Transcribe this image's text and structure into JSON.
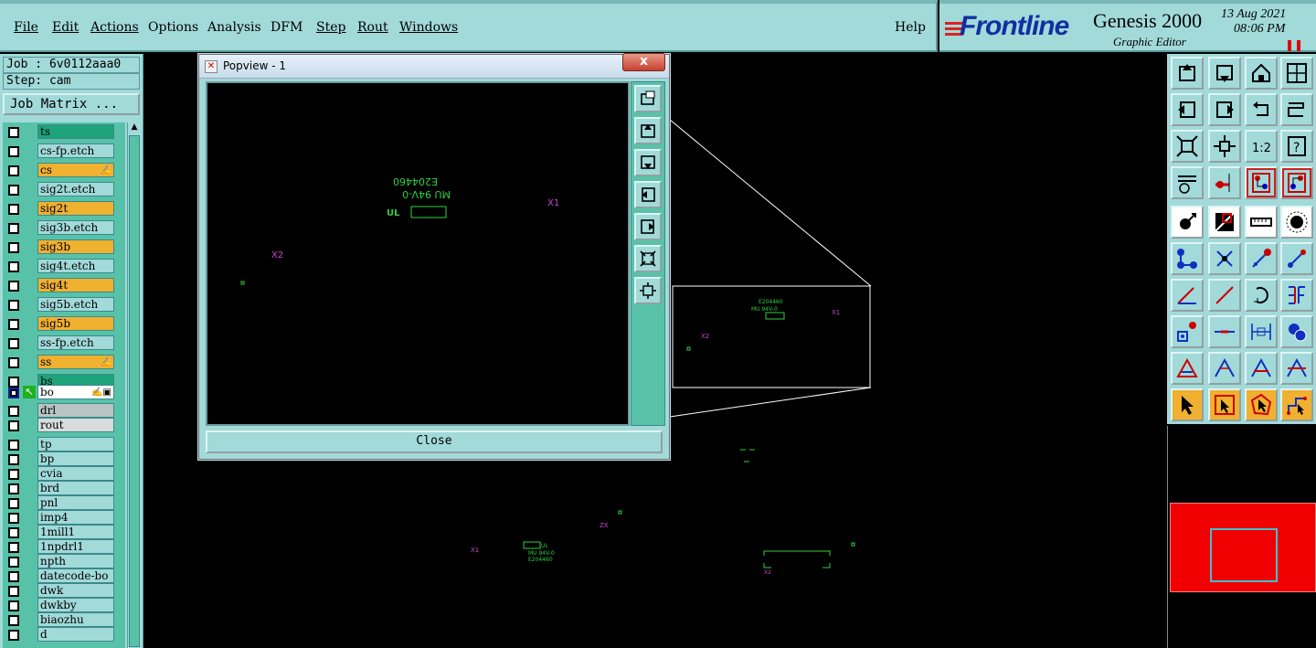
{
  "menubar": {
    "items": [
      {
        "label": "File"
      },
      {
        "label": "Edit"
      },
      {
        "label": "Actions"
      },
      {
        "label": "Options"
      },
      {
        "label": "Analysis"
      },
      {
        "label": "DFM"
      },
      {
        "label": "Step"
      },
      {
        "label": "Rout"
      },
      {
        "label": "Windows"
      }
    ],
    "help": "Help"
  },
  "logo": {
    "brand": "Frontline",
    "product": "Genesis 2000",
    "subtitle": "Graphic Editor",
    "date": "13 Aug 2021",
    "time": "08:06 PM",
    "pause_icon": "pause-icon",
    "brand_color": "#1030a0",
    "accent_color": "#e02020"
  },
  "job": {
    "job_line": "Job : 6v0112aaa0",
    "step_line": "Step: cam",
    "matrix_button": "Job Matrix ..."
  },
  "layers": [
    {
      "name": "ts",
      "color": "#1fa37a",
      "mark": ""
    },
    {
      "name": "cs-fp.etch",
      "color": "#a2d9d9",
      "mark": ""
    },
    {
      "name": "cs",
      "color": "#f0b030",
      "mark": "✍"
    },
    {
      "name": "sig2t.etch",
      "color": "#a2d9d9",
      "mark": ""
    },
    {
      "name": "sig2t",
      "color": "#f0b030",
      "mark": ""
    },
    {
      "name": "sig3b.etch",
      "color": "#a2d9d9",
      "mark": ""
    },
    {
      "name": "sig3b",
      "color": "#f0b030",
      "mark": ""
    },
    {
      "name": "sig4t.etch",
      "color": "#a2d9d9",
      "mark": ""
    },
    {
      "name": "sig4t",
      "color": "#f0b030",
      "mark": ""
    },
    {
      "name": "sig5b.etch",
      "color": "#a2d9d9",
      "mark": ""
    },
    {
      "name": "sig5b",
      "color": "#f0b030",
      "mark": ""
    },
    {
      "name": "ss-fp.etch",
      "color": "#a2d9d9",
      "mark": ""
    },
    {
      "name": "ss",
      "color": "#f0b030",
      "mark": "✍"
    },
    {
      "name": "bs",
      "color": "#1fa37a",
      "mark": ""
    },
    {
      "name": "bo",
      "color": "#ffffff",
      "mark": "✍▣",
      "selected": true
    },
    {
      "name": "drl",
      "color": "#b8c4c4",
      "mark": ""
    },
    {
      "name": "rout",
      "color": "#d8dcdc",
      "mark": ""
    },
    {
      "name": "tp",
      "color": "#a2d9d9",
      "mark": ""
    },
    {
      "name": "bp",
      "color": "#a2d9d9",
      "mark": ""
    },
    {
      "name": "cvia",
      "color": "#a2d9d9",
      "mark": ""
    },
    {
      "name": "brd",
      "color": "#a2d9d9",
      "mark": ""
    },
    {
      "name": "pnl",
      "color": "#a2d9d9",
      "mark": ""
    },
    {
      "name": "imp4",
      "color": "#a2d9d9",
      "mark": ""
    },
    {
      "name": "1mill1",
      "color": "#a2d9d9",
      "mark": ""
    },
    {
      "name": "1npdrl1",
      "color": "#a2d9d9",
      "mark": ""
    },
    {
      "name": "npth",
      "color": "#a2d9d9",
      "mark": ""
    },
    {
      "name": "datecode-bo",
      "color": "#a2d9d9",
      "mark": ""
    },
    {
      "name": "dwk",
      "color": "#a2d9d9",
      "mark": ""
    },
    {
      "name": "dwkby",
      "color": "#a2d9d9",
      "mark": ""
    },
    {
      "name": "biaozhu",
      "color": "#a2d9d9",
      "mark": ""
    },
    {
      "name": "d",
      "color": "#a2d9d9",
      "mark": ""
    }
  ],
  "canvas": {
    "labels": {
      "x1": "X1",
      "x2": "X2",
      "small_x1": "X1",
      "small_x2": "X2",
      "zx": "ZX"
    },
    "board_text_1": "E204460",
    "board_text_2": "MU 94V-0",
    "board_logo": "UL"
  },
  "popview": {
    "title": "Popview - 1",
    "close_x": "x",
    "close_button": "Close",
    "tools": [
      "zoom-box-icon",
      "page-up-icon",
      "page-down-icon",
      "page-left-icon",
      "page-right-icon",
      "zoom-fit-icon",
      "zoom-home-icon"
    ]
  },
  "toolbar": {
    "rows": [
      [
        "page-up-icon",
        "page-down-icon",
        "home-icon",
        "window-icon"
      ],
      [
        "page-left-icon",
        "page-right-icon",
        "undo-icon",
        "redo-icon"
      ],
      [
        "zoom-fit-icon",
        "zoom-center-icon",
        "scale-1-2-icon",
        "help-icon"
      ],
      [
        "measure-tool-icon",
        "snap-line-icon",
        "layer-net-icon",
        "layer-net-2-icon"
      ],
      [
        "pad-add-icon",
        "feature-box-icon",
        "ruler-icon",
        "circle-pad-icon"
      ],
      [
        "net-connect-icon",
        "cross-icon",
        "line-pad-icon",
        "line-pad-2-icon"
      ],
      [
        "line-angle-icon",
        "line-diag-icon",
        "arc-icon",
        "symbol-f-icon"
      ],
      [
        "move-pad-icon",
        "line-horiz-icon",
        "dim-width-icon",
        "copy-pad-icon"
      ],
      [
        "shape-a-icon",
        "shape-a2-icon",
        "shape-a3-icon",
        "shape-a4-icon"
      ],
      [
        "pointer-icon",
        "select-box-icon",
        "select-poly-icon",
        "select-path-icon"
      ]
    ]
  }
}
